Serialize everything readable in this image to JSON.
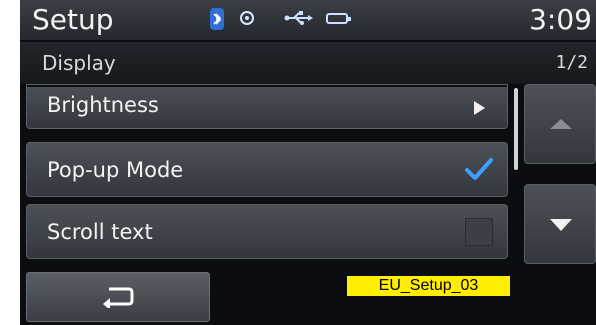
{
  "header": {
    "title": "Setup",
    "time": "3:09",
    "status_icons": [
      "bluetooth-icon",
      "disc-icon",
      "usb-icon",
      "battery-icon"
    ]
  },
  "subheader": {
    "title": "Display",
    "page": "1/2"
  },
  "menu": {
    "items": [
      {
        "label": "Brightness",
        "control": "submenu-arrow"
      },
      {
        "label": "Pop-up Mode",
        "control": "checkbox",
        "checked": true
      },
      {
        "label": "Scroll text",
        "control": "checkbox",
        "checked": false
      }
    ]
  },
  "navigation": {
    "up_icon": "triangle-up-icon",
    "down_icon": "triangle-down-icon",
    "back_icon": "back-arrow-icon"
  },
  "caption": "EU_Setup_03",
  "colors": {
    "accent_check": "#3fa0ff",
    "caption_background": "#ffee00",
    "bluetooth": "#2f6fd6"
  }
}
